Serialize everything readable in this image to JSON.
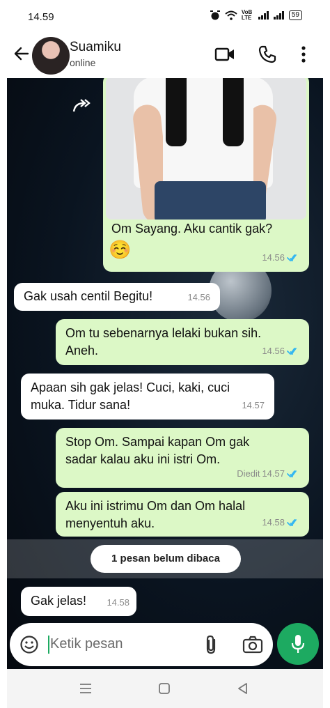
{
  "status_bar": {
    "time": "14.59",
    "network_label": "VoB LTE",
    "battery": "59"
  },
  "header": {
    "contact_name": "Suamiku",
    "contact_status": "online"
  },
  "messages": [
    {
      "direction": "out",
      "text": "Om Sayang. Aku cantik gak?",
      "emoji": "☺️",
      "time": "14.56",
      "read": true,
      "has_image": true
    },
    {
      "direction": "in",
      "text": "Gak usah centil Begitu!",
      "time": "14.56"
    },
    {
      "direction": "out",
      "text": "Om tu sebenarnya lelaki bukan sih. Aneh.",
      "time": "14.56",
      "read": true
    },
    {
      "direction": "in",
      "text": "Apaan sih gak jelas! Cuci, kaki, cuci muka. Tidur sana!",
      "time": "14.57"
    },
    {
      "direction": "out",
      "text": "Stop Om. Sampai kapan Om gak sadar kalau aku ini istri Om.",
      "edited_label": "Diedit",
      "time": "14.57",
      "read": true
    },
    {
      "direction": "out",
      "text": "Aku ini istrimu Om dan Om halal menyentuh aku.",
      "time": "14.58",
      "read": true
    },
    {
      "direction": "in",
      "text": "Gak jelas!",
      "time": "14.58"
    }
  ],
  "unread_banner": "1 pesan belum dibaca",
  "composer": {
    "placeholder": "Ketik pesan"
  },
  "colors": {
    "outgoing_bubble": "#dcf8c6",
    "incoming_bubble": "#ffffff",
    "accent_green": "#1daa61",
    "read_tick": "#34b7f1"
  },
  "icons": [
    "back-arrow-icon",
    "video-call-icon",
    "phone-icon",
    "more-vert-icon",
    "forward-icon",
    "emoji-icon",
    "attach-icon",
    "camera-icon",
    "mic-icon"
  ]
}
